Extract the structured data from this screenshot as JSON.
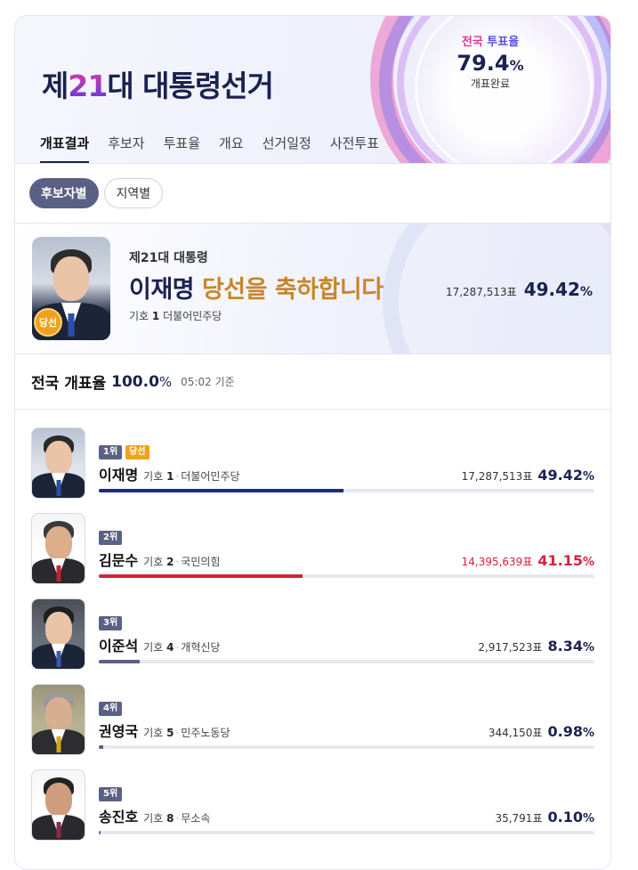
{
  "header": {
    "title_prefix": "제",
    "title_num": "21",
    "title_suffix": "대 대통령선거",
    "turnout_label_a": "전국 ",
    "turnout_label_b": "투표율",
    "turnout_value": "79.4",
    "turnout_unit": "%",
    "turnout_sub": "개표완료"
  },
  "tabs": [
    "개표결과",
    "후보자",
    "투표율",
    "개요",
    "선거일정",
    "사전투표"
  ],
  "filters": {
    "candidate": "후보자별",
    "region": "지역별"
  },
  "winner": {
    "sub": "제21대 대통령",
    "name": "이재명",
    "congrats": "당선을 축하합니다",
    "number_label": "기호",
    "number": "1",
    "party": "더불어민주당",
    "votes": "17,287,513표",
    "pct": "49.42",
    "pct_unit": "%",
    "badge": "당선"
  },
  "national": {
    "label": "전국 개표율",
    "rate": "100.0",
    "unit": "%",
    "time": "05:02 기준"
  },
  "candidates": [
    {
      "rank": "1위",
      "elected": "당선",
      "name": "이재명",
      "number_label": "기호",
      "number": "1",
      "party": "더불어민주당",
      "votes": "17,287,513표",
      "pct": "49.42",
      "unit": "%",
      "share": 0.4942,
      "color": "#1d2a7a"
    },
    {
      "rank": "2위",
      "name": "김문수",
      "number_label": "기호",
      "number": "2",
      "party": "국민의힘",
      "votes": "14,395,639표",
      "pct": "41.15",
      "unit": "%",
      "share": 0.4115,
      "color": "#d8213b"
    },
    {
      "rank": "3위",
      "name": "이준석",
      "number_label": "기호",
      "number": "4",
      "party": "개혁신당",
      "votes": "2,917,523표",
      "pct": "8.34",
      "unit": "%",
      "share": 0.0834,
      "color": "#5b6185"
    },
    {
      "rank": "4위",
      "name": "권영국",
      "number_label": "기호",
      "number": "5",
      "party": "민주노동당",
      "votes": "344,150표",
      "pct": "0.98",
      "unit": "%",
      "share": 0.0098,
      "color": "#5b6185"
    },
    {
      "rank": "5위",
      "name": "송진호",
      "number_label": "기호",
      "number": "8",
      "party": "무소속",
      "votes": "35,791표",
      "pct": "0.10",
      "unit": "%",
      "share": 0.001,
      "color": "#5b6185"
    }
  ]
}
